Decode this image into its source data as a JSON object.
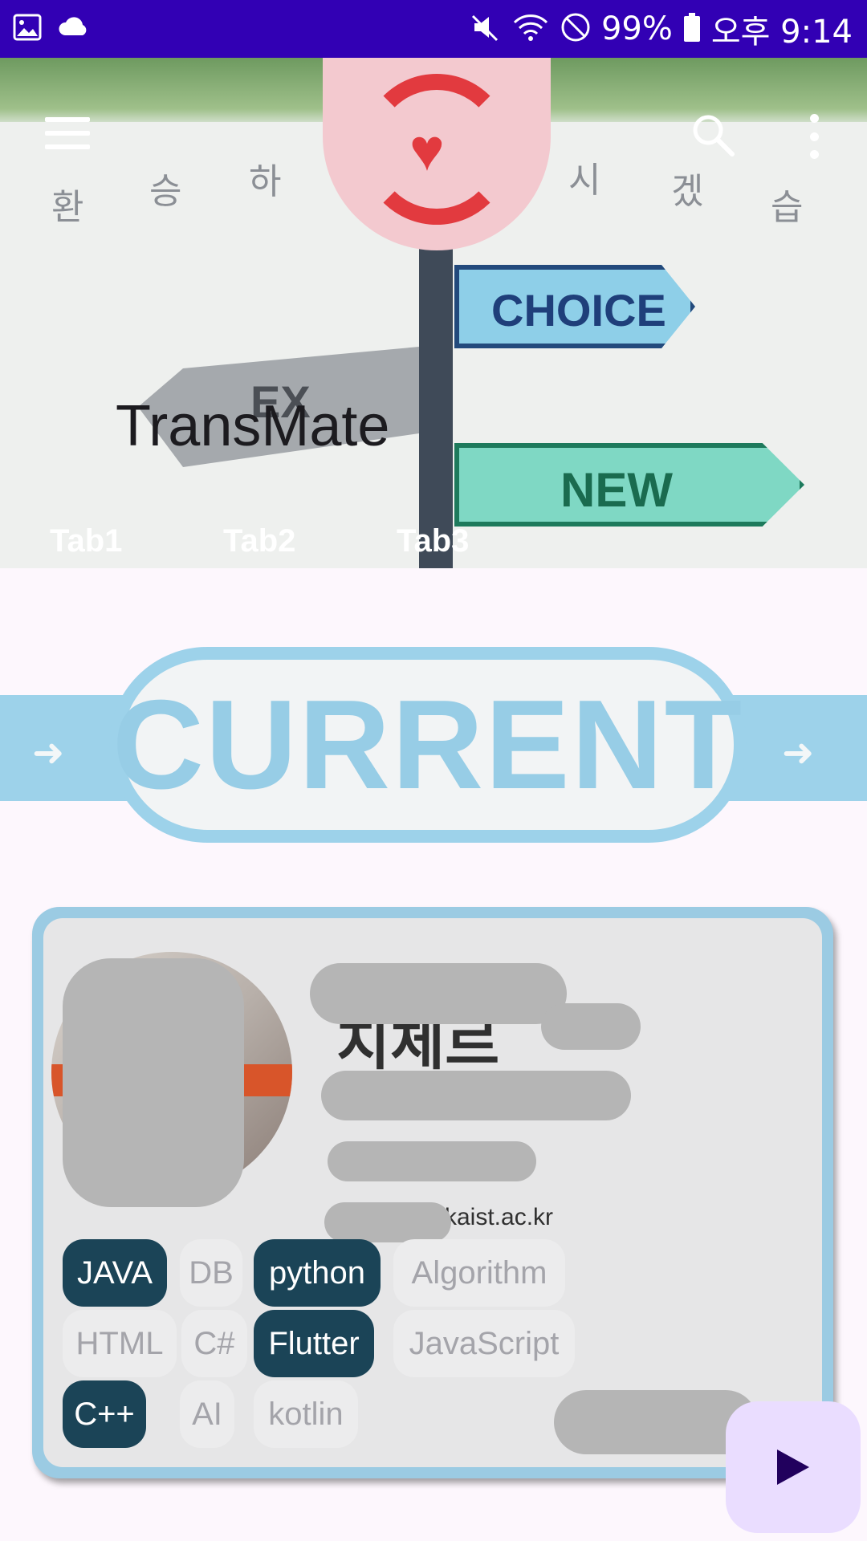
{
  "status_bar": {
    "battery": "99%",
    "time": "오후 9:14",
    "left_icons": [
      "image-icon",
      "cloud-icon"
    ],
    "right_icons": [
      "mute-icon",
      "wifi-icon",
      "do-not-disturb-icon",
      "battery-icon"
    ]
  },
  "header": {
    "app_title": "TransMate",
    "wall_text": [
      "환",
      "승",
      "하",
      "시",
      "겠",
      "습"
    ],
    "signs": {
      "choice": "CHOICE",
      "new": "NEW",
      "ex": "EX"
    },
    "tabs": [
      "Tab1",
      "Tab2",
      "Tab3"
    ]
  },
  "banner": {
    "text": "CURRENT"
  },
  "profile": {
    "email_suffix": "kaist.ac.kr",
    "skills": [
      {
        "label": "JAVA",
        "selected": true
      },
      {
        "label": "DB",
        "selected": false
      },
      {
        "label": "python",
        "selected": true
      },
      {
        "label": "Algorithm",
        "selected": false
      },
      {
        "label": "HTML",
        "selected": false
      },
      {
        "label": "C#",
        "selected": false
      },
      {
        "label": "Flutter",
        "selected": true
      },
      {
        "label": "JavaScript",
        "selected": false
      },
      {
        "label": "C++",
        "selected": true
      },
      {
        "label": "AI",
        "selected": false
      },
      {
        "label": "kotlin",
        "selected": false
      }
    ]
  },
  "colors": {
    "status_bar": "#3200b4",
    "chip_selected": "#1b4457",
    "chip_unselected_text": "#a4a4aa",
    "card_border": "#9bcbe3",
    "fab_bg": "#eaddff",
    "fab_icon": "#21005d"
  }
}
